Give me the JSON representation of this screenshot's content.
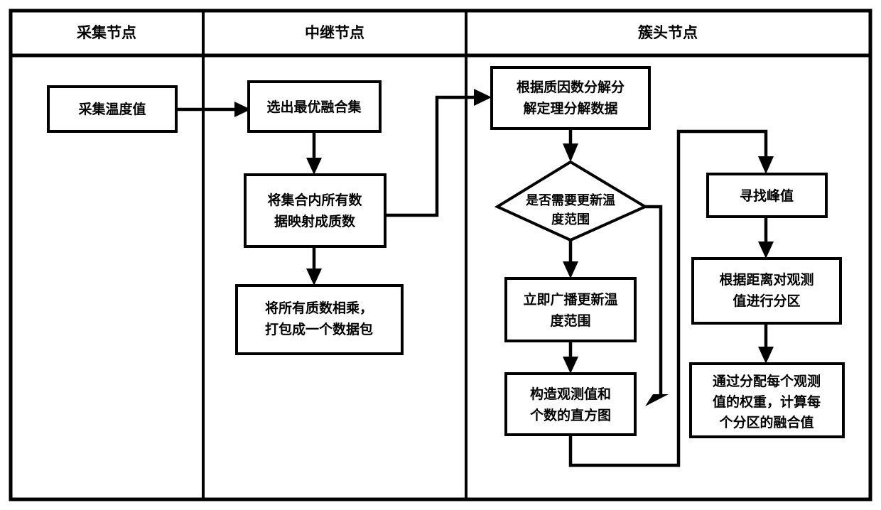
{
  "diagram": {
    "type": "swimlane-flowchart",
    "title": "",
    "lanes": [
      {
        "id": "collect",
        "label": "采集节点"
      },
      {
        "id": "relay",
        "label": "中继节点"
      },
      {
        "id": "clusterhead",
        "label": "簇头节点"
      }
    ],
    "nodes": [
      {
        "id": "n1",
        "lane": "collect",
        "shape": "rect",
        "lines": [
          "采集温度值"
        ]
      },
      {
        "id": "n2",
        "lane": "relay",
        "shape": "rect",
        "lines": [
          "选出最优融合集"
        ]
      },
      {
        "id": "n3",
        "lane": "relay",
        "shape": "rect",
        "lines": [
          "将集合内所有数",
          "据映射成质数"
        ]
      },
      {
        "id": "n4",
        "lane": "relay",
        "shape": "rect",
        "lines": [
          "将所有质数相乘，",
          "打包成一个数据包"
        ]
      },
      {
        "id": "n5",
        "lane": "clusterhead",
        "shape": "rect",
        "lines": [
          "根据质因数分解分",
          "解定理分解数据"
        ]
      },
      {
        "id": "n6",
        "lane": "clusterhead",
        "shape": "diamond",
        "lines": [
          "是否需要更新温",
          "度范围"
        ]
      },
      {
        "id": "n7",
        "lane": "clusterhead",
        "shape": "rect",
        "lines": [
          "立即广播更新温",
          "度范围"
        ]
      },
      {
        "id": "n8",
        "lane": "clusterhead",
        "shape": "rect",
        "lines": [
          "构造观测值和",
          "个数的直方图"
        ]
      },
      {
        "id": "n9",
        "lane": "clusterhead",
        "shape": "rect",
        "lines": [
          "寻找峰值"
        ]
      },
      {
        "id": "n10",
        "lane": "clusterhead",
        "shape": "rect",
        "lines": [
          "根据距离对观测",
          "值进行分区"
        ]
      },
      {
        "id": "n11",
        "lane": "clusterhead",
        "shape": "rect",
        "lines": [
          "通过分配每个观测",
          "值的权重，计算每",
          "个分区的融合值"
        ]
      }
    ],
    "edges": [
      {
        "id": "e1",
        "from": "n1",
        "to": "n2",
        "label": ""
      },
      {
        "id": "e2",
        "from": "n2",
        "to": "n3",
        "label": ""
      },
      {
        "id": "e3",
        "from": "n3",
        "to": "n4",
        "label": ""
      },
      {
        "id": "e4",
        "from": "n3",
        "to": "n5",
        "label": ""
      },
      {
        "id": "e5",
        "from": "n5",
        "to": "n6",
        "label": ""
      },
      {
        "id": "e6",
        "from": "n6",
        "to": "n7",
        "label": ""
      },
      {
        "id": "e7",
        "from": "n6",
        "to": "n8",
        "label": ""
      },
      {
        "id": "e8",
        "from": "n7",
        "to": "n8",
        "label": ""
      },
      {
        "id": "e9",
        "from": "n8",
        "to": "n9",
        "label": ""
      },
      {
        "id": "e10",
        "from": "n9",
        "to": "n10",
        "label": ""
      },
      {
        "id": "e11",
        "from": "n10",
        "to": "n11",
        "label": ""
      }
    ],
    "colors": {
      "stroke": "#000000",
      "fill": "#ffffff",
      "background": "#ffffff"
    }
  }
}
